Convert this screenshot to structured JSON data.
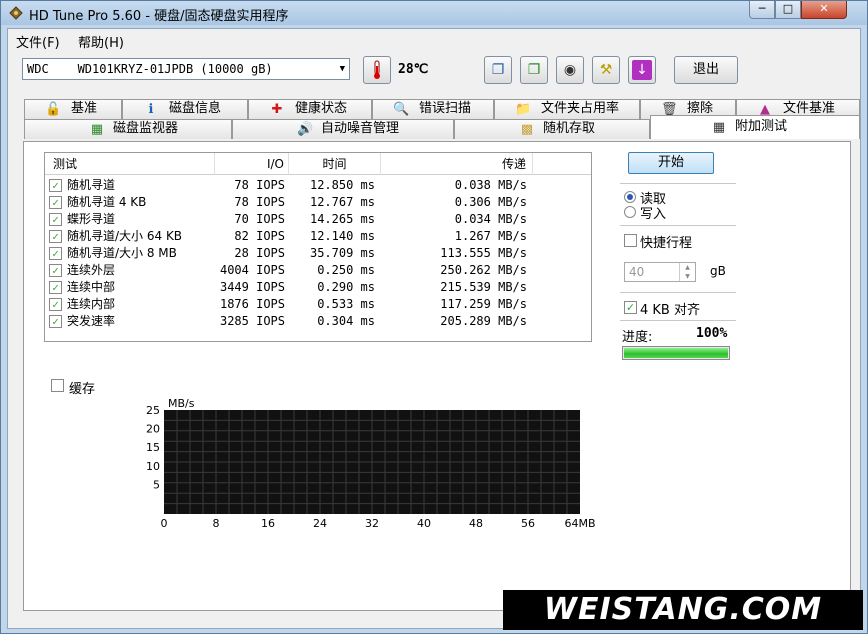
{
  "window": {
    "title": "HD Tune Pro 5.60 - 硬盘/固态硬盘实用程序"
  },
  "menu": [
    {
      "label": "文件(F)"
    },
    {
      "label": "帮助(H)"
    }
  ],
  "toolbar": {
    "drive": "WDC    WD101KRYZ-01JPDB (10000 gB)",
    "temperature": "28℃",
    "exit_label": "退出"
  },
  "tabs_top": [
    {
      "label": "基准",
      "icon": "gauge-icon"
    },
    {
      "label": "磁盘信息",
      "icon": "info-icon"
    },
    {
      "label": "健康状态",
      "icon": "health-cross-icon"
    },
    {
      "label": "错误扫描",
      "icon": "magnifier-icon"
    },
    {
      "label": "文件夹占用率",
      "icon": "folder-icon"
    },
    {
      "label": "擦除",
      "icon": "trash-icon"
    },
    {
      "label": "文件基准",
      "icon": "file-benchmark-icon"
    }
  ],
  "tabs_bottom": [
    {
      "label": "磁盘监视器",
      "icon": "monitor-chart-icon"
    },
    {
      "label": "自动噪音管理",
      "icon": "speaker-icon"
    },
    {
      "label": "随机存取",
      "icon": "random-grid-icon"
    },
    {
      "label": "附加测试",
      "icon": "extra-tests-icon"
    }
  ],
  "table": {
    "headers": [
      "测试",
      "I/O",
      "时间",
      "传递"
    ],
    "rows": [
      {
        "name": "随机寻道",
        "io": "78 IOPS",
        "time": "12.850 ms",
        "transfer": "0.038 MB/s",
        "checked": true
      },
      {
        "name": "随机寻道 4 KB",
        "io": "78 IOPS",
        "time": "12.767 ms",
        "transfer": "0.306 MB/s",
        "checked": true
      },
      {
        "name": "蝶形寻道",
        "io": "70 IOPS",
        "time": "14.265 ms",
        "transfer": "0.034 MB/s",
        "checked": true
      },
      {
        "name": "随机寻道/大小 64 KB",
        "io": "82 IOPS",
        "time": "12.140 ms",
        "transfer": "1.267 MB/s",
        "checked": true
      },
      {
        "name": "随机寻道/大小 8 MB",
        "io": "28 IOPS",
        "time": "35.709 ms",
        "transfer": "113.555 MB/s",
        "checked": true
      },
      {
        "name": "连续外层",
        "io": "4004 IOPS",
        "time": "0.250 ms",
        "transfer": "250.262 MB/s",
        "checked": true
      },
      {
        "name": "连续中部",
        "io": "3449 IOPS",
        "time": "0.290 ms",
        "transfer": "215.539 MB/s",
        "checked": true
      },
      {
        "name": "连续内部",
        "io": "1876 IOPS",
        "time": "0.533 ms",
        "transfer": "117.259 MB/s",
        "checked": true
      },
      {
        "name": "突发速率",
        "io": "3285 IOPS",
        "time": "0.304 ms",
        "transfer": "205.289 MB/s",
        "checked": true
      }
    ]
  },
  "cache": {
    "label": "缓存",
    "checked": false
  },
  "chart": {
    "unit": "MB/s",
    "y_ticks": [
      "25",
      "20",
      "15",
      "10",
      "5"
    ],
    "x_ticks": [
      "0",
      "8",
      "16",
      "24",
      "32",
      "40",
      "48",
      "56",
      "64MB"
    ]
  },
  "controls": {
    "start_label": "开始",
    "read_label": "读取",
    "write_label": "写入",
    "mode": "read",
    "quick_label": "快捷行程",
    "quick_checked": false,
    "quick_value": "40",
    "quick_unit": "gB",
    "align_label": "4 KB 对齐",
    "align_checked": true,
    "progress_label": "进度:",
    "progress_value": "100%",
    "progress_fraction": 1.0
  },
  "watermark": "WEISTANG.COM"
}
